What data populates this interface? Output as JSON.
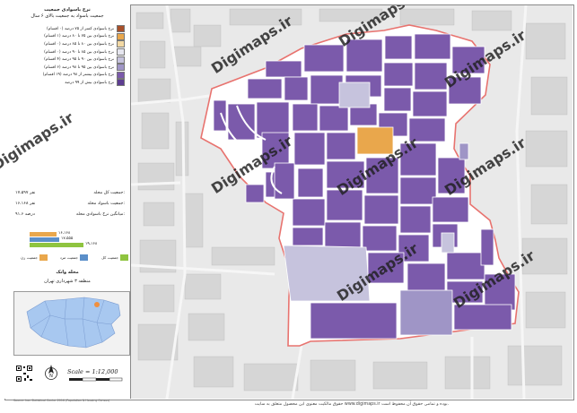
{
  "title": {
    "line1": "نرخ باسوادی جمعیت",
    "line2": "جمعیت باسواد به جمعیت بالای ۶ سال"
  },
  "legend": [
    {
      "label": "نرخ باسوادی کمتر از ۷۵ درصد (۰ اقسام)",
      "color": "#a8502a"
    },
    {
      "label": "نرخ باسوادی بین ۷۵ تا ۸۰ درصد (۱ اقسام)",
      "color": "#e9a74c"
    },
    {
      "label": "نرخ باسوادی بین ۸۰ تا ۸۵ درصد (۰ اقسام)",
      "color": "#f3d9a4"
    },
    {
      "label": "نرخ باسوادی بین ۸۵ تا ۹۰ درصد (۰ اقسام)",
      "color": "#e6e6ef"
    },
    {
      "label": "نرخ باسوادی بین ۹۰ تا ۹۵ درصد (۴ اقسام)",
      "color": "#c6c3dd"
    },
    {
      "label": "نرخ باسوادی بین ۹۵ تا ۹۸ درصد (۶ اقسام)",
      "color": "#9f95c6"
    },
    {
      "label": "نرخ باسوادی بیشتر از ۹۸ درصد (۱۹ اقسام)",
      "color": "#7b5aab"
    },
    {
      "label": "نرخ باسوادی بیش از ۹۹ درصد",
      "color": "#5d3d91"
    }
  ],
  "stats": [
    {
      "key": "جمعیت کل محله:",
      "value": "۱۷،۵۹۷ نفر"
    },
    {
      "key": "جمعیت باسواد محله:",
      "value": "۱۶،۱۶۸ نفر"
    },
    {
      "key": "میانگین نرخ باسوادی محله:",
      "value": "۹۱.۶ درصد"
    }
  ],
  "bars": [
    {
      "label": "۱۶،۱۶۸",
      "value": 16168,
      "color": "#e9a74c"
    },
    {
      "label": "۱۷،۵۵۵",
      "value": 17555,
      "color": "#5b8fc9"
    },
    {
      "label": "۱۹،۱۶۸",
      "value": 19168,
      "color": "#8fc43f"
    }
  ],
  "mini_legend": [
    {
      "label": "جمعیت کل",
      "color": "#8fc43f"
    },
    {
      "label": "جمعیت مرد",
      "color": "#5b8fc9"
    },
    {
      "label": "جمعیت زن",
      "color": "#e9a74c"
    }
  ],
  "inset": {
    "title": "محله وانک",
    "subtitle": "منطقه ۳ شهرداری تهران"
  },
  "scale": "Scale = 1:12,000",
  "footer": "حقوق مالکیت معنوی این محصول متعلق به سایت www.digimaps.ir بوده و تمامی حقوق آن محفوظ است.",
  "credit": "Source: Iran Statistical Center 2016 (Population & Housing Census)",
  "watermark": "Digimaps.ir",
  "colors": {
    "block_dark": "#7b5aab",
    "block_light": "#c6c3dd",
    "block_mid": "#9f95c6",
    "block_orange": "#e9a74c",
    "boundary": "#e8736f",
    "bg": "#e9e9e9"
  }
}
